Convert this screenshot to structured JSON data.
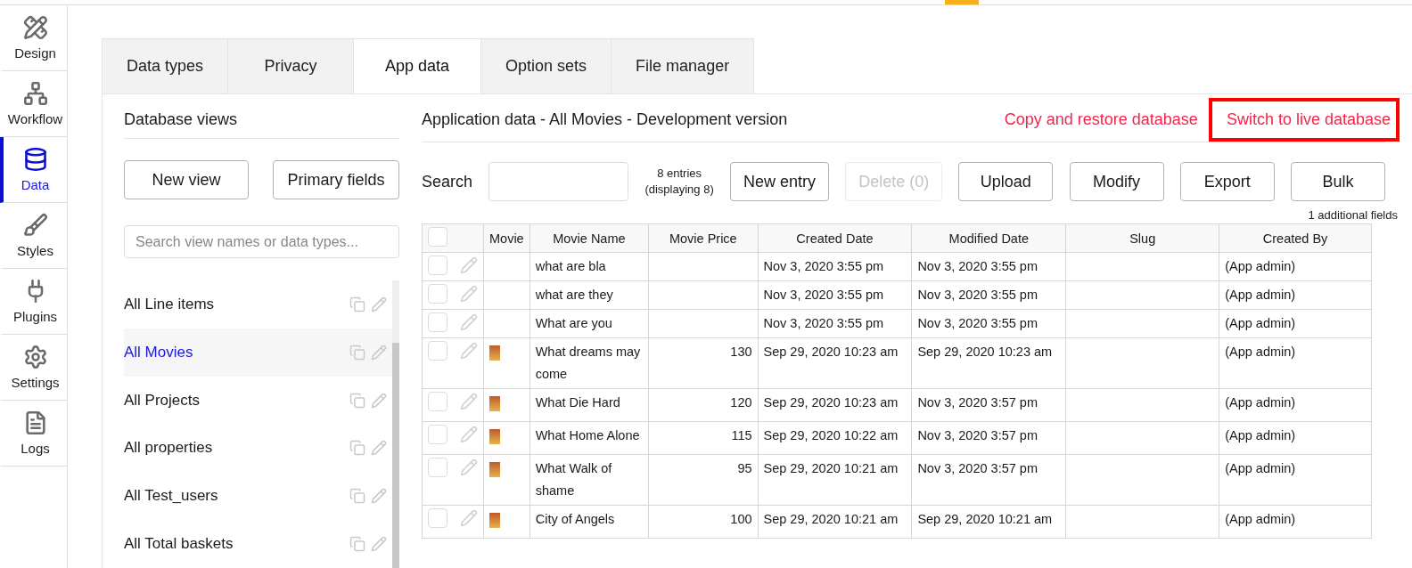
{
  "sidebar": {
    "items": [
      {
        "label": "Design",
        "selected": false
      },
      {
        "label": "Workflow",
        "selected": false
      },
      {
        "label": "Data",
        "selected": true
      },
      {
        "label": "Styles",
        "selected": false
      },
      {
        "label": "Plugins",
        "selected": false
      },
      {
        "label": "Settings",
        "selected": false
      },
      {
        "label": "Logs",
        "selected": false
      }
    ]
  },
  "tabs": [
    {
      "label": "Data types",
      "selected": false
    },
    {
      "label": "Privacy",
      "selected": false
    },
    {
      "label": "App data",
      "selected": true
    },
    {
      "label": "Option sets",
      "selected": false
    },
    {
      "label": "File manager",
      "selected": false
    }
  ],
  "views": {
    "title": "Database views",
    "buttons": [
      "New view",
      "Primary fields"
    ],
    "search": {
      "placeholder": "Search view names or data types..."
    },
    "items": [
      {
        "label": "All Line items",
        "selected": false
      },
      {
        "label": "All Movies",
        "selected": true
      },
      {
        "label": "All Projects",
        "selected": false
      },
      {
        "label": "All properties",
        "selected": false
      },
      {
        "label": "All Test_users",
        "selected": false
      },
      {
        "label": "All Total baskets",
        "selected": false
      }
    ]
  },
  "data": {
    "title": "Application data - All Movies - Development version",
    "links": [
      "Copy and restore database",
      "Switch to live database"
    ],
    "search_label": "Search",
    "count": "8 entries",
    "displaying": "(displaying 8)",
    "buttons": [
      {
        "label": "New entry",
        "disabled": false
      },
      {
        "label": "Delete (0)",
        "disabled": true
      },
      {
        "label": "Upload",
        "disabled": false
      },
      {
        "label": "Modify",
        "disabled": false
      },
      {
        "label": "Export",
        "disabled": false
      },
      {
        "label": "Bulk",
        "disabled": false
      }
    ],
    "additional": "1 additional fields",
    "table": {
      "header_checked": false,
      "columns": [
        "Movie",
        "Movie Name",
        "Movie Price",
        "Created Date",
        "Modified Date",
        "Slug",
        "Created By"
      ],
      "rows": [
        {
          "checked": false,
          "image": false,
          "cells": [
            "",
            "what are bla",
            "",
            "Nov 3, 2020 3:55 pm",
            "Nov 3, 2020 3:55 pm",
            "",
            "(App admin)"
          ]
        },
        {
          "checked": false,
          "image": false,
          "cells": [
            "",
            "what are they",
            "",
            "Nov 3, 2020 3:55 pm",
            "Nov 3, 2020 3:55 pm",
            "",
            "(App admin)"
          ]
        },
        {
          "checked": false,
          "image": false,
          "cells": [
            "",
            "What are you",
            "",
            "Nov 3, 2020 3:55 pm",
            "Nov 3, 2020 3:55 pm",
            "",
            "(App admin)"
          ]
        },
        {
          "checked": false,
          "image": true,
          "cells": [
            "",
            "What dreams may come",
            "130",
            "Sep 29, 2020 10:23 am",
            "Sep 29, 2020 10:23 am",
            "",
            "(App admin)"
          ]
        },
        {
          "checked": false,
          "image": true,
          "cells": [
            "",
            "What Die Hard",
            "120",
            "Sep 29, 2020 10:23 am",
            "Nov 3, 2020 3:57 pm",
            "",
            "(App admin)"
          ]
        },
        {
          "checked": false,
          "image": true,
          "cells": [
            "",
            "What Home Alone",
            "115",
            "Sep 29, 2020 10:22 am",
            "Nov 3, 2020 3:57 pm",
            "",
            "(App admin)"
          ]
        },
        {
          "checked": false,
          "image": true,
          "cells": [
            "",
            "What Walk of shame",
            "95",
            "Sep 29, 2020 10:21 am",
            "Nov 3, 2020 3:57 pm",
            "",
            "(App admin)"
          ]
        },
        {
          "checked": false,
          "image": true,
          "cells": [
            "",
            "City of Angels",
            "100",
            "Sep 29, 2020 10:21 am",
            "Sep 29, 2020 10:21 am",
            "",
            "(App admin)"
          ]
        }
      ]
    }
  }
}
